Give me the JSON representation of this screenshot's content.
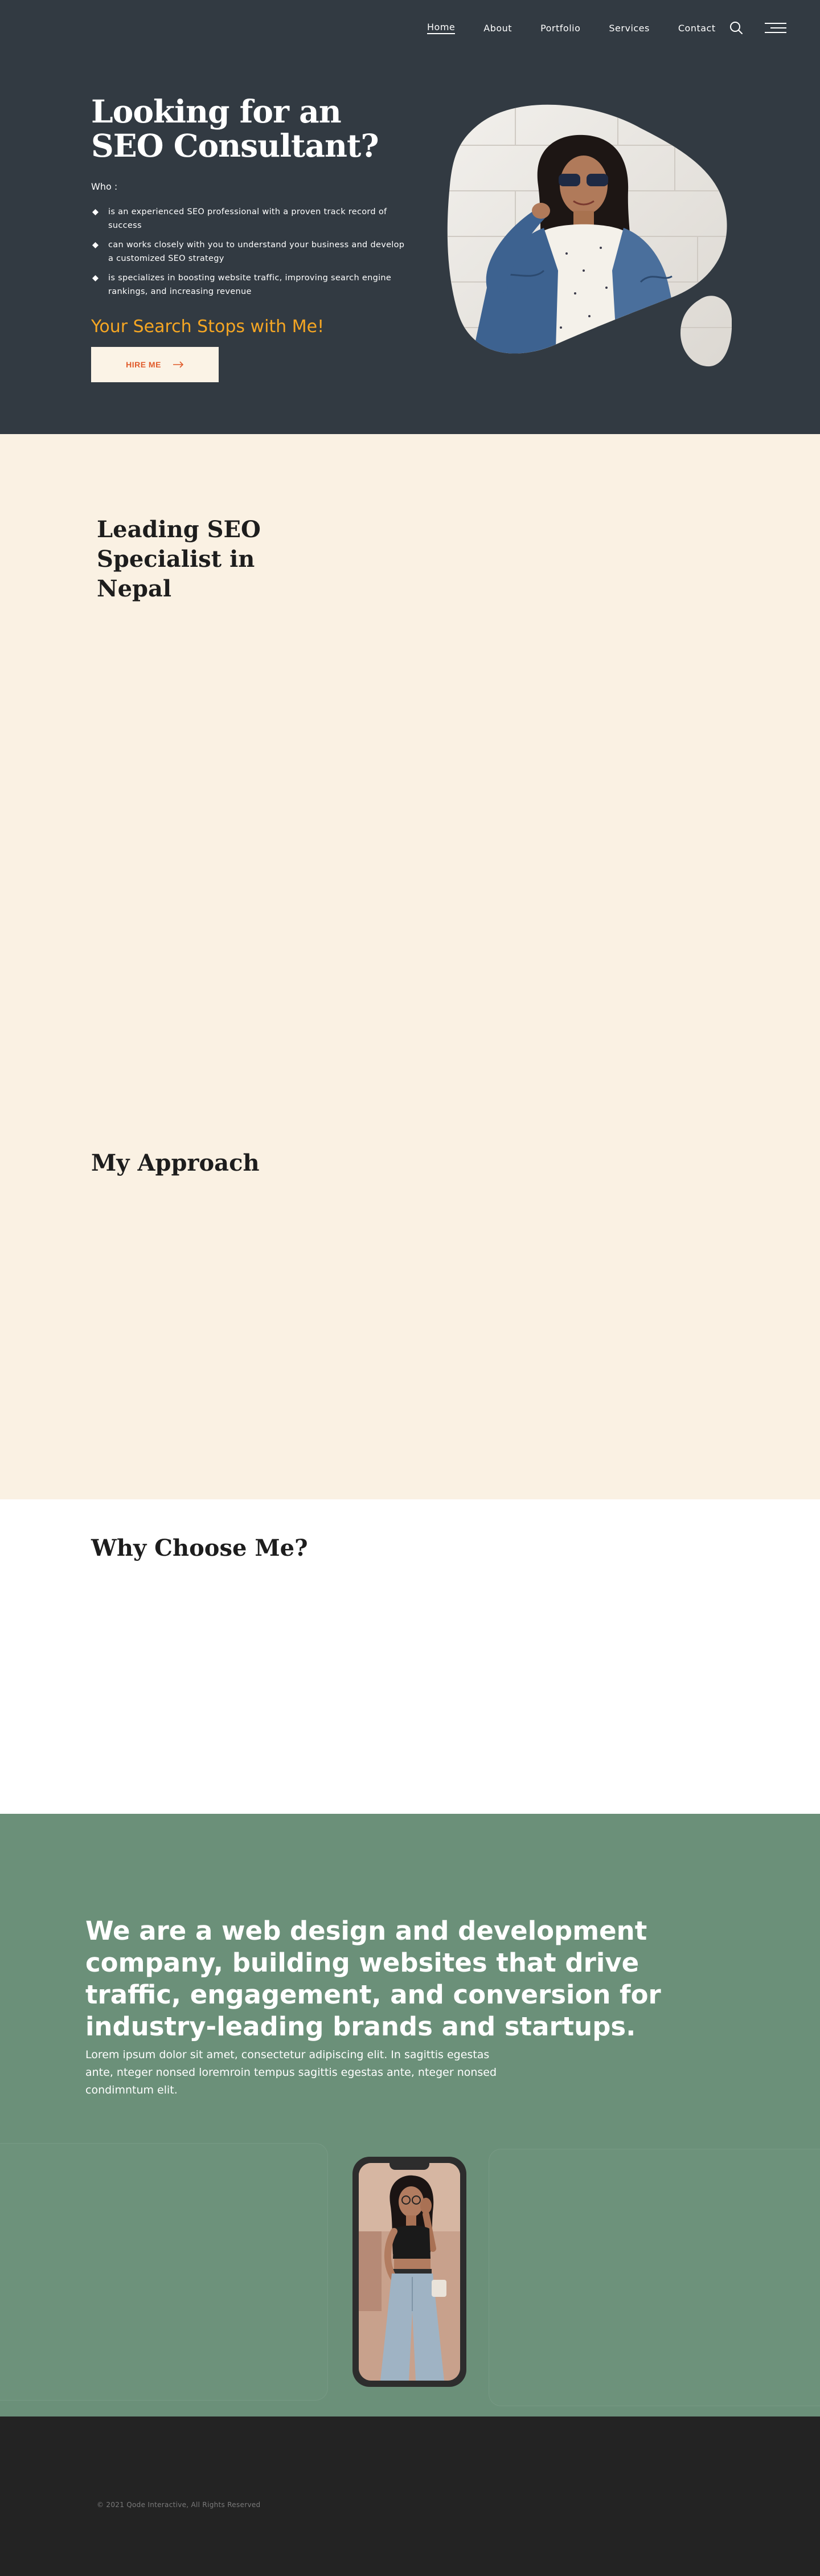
{
  "nav": {
    "items": [
      {
        "label": "Home",
        "active": true
      },
      {
        "label": "About",
        "active": false
      },
      {
        "label": "Portfolio",
        "active": false
      },
      {
        "label": "Services",
        "active": false
      },
      {
        "label": "Contact",
        "active": false
      }
    ],
    "search_icon": "search-icon",
    "menu_icon": "hamburger-menu-icon"
  },
  "hero": {
    "title": "Looking for an SEO Consultant?",
    "who_label": "Who :",
    "bullets": [
      "is an experienced SEO professional with a proven track record of success",
      "can works closely with you to understand your business and develop a customized SEO strategy",
      "is specializes in boosting website traffic, improving search engine rankings, and increasing revenue"
    ],
    "bullet_icon": "diamond-icon",
    "tagline": "Your Search Stops with Me!",
    "cta_label": "HIRE ME",
    "cta_icon": "arrow-right-icon",
    "colors": {
      "background": "#323a42",
      "accent": "#f5a623",
      "cta_text": "#e05a2a",
      "cta_bg": "#fbf3e6"
    }
  },
  "leading": {
    "title": "Leading SEO Specialist in Nepal"
  },
  "approach": {
    "title": "My Approach"
  },
  "why": {
    "title": "Why Choose Me?"
  },
  "company": {
    "headline": "We are a web design and development company, building websites that drive traffic, engagement, and conversion for industry-leading brands and startups.",
    "body": "Lorem ipsum dolor sit amet, consectetur adipiscing elit. In sagittis egestas ante, nteger nonsed loremroin tempus sagittis egestas ante, nteger nonsed condimntum elit.",
    "colors": {
      "background": "#6b9079"
    }
  },
  "footer": {
    "copyright": "© 2021 Qode Interactive, All Rights Reserved"
  }
}
